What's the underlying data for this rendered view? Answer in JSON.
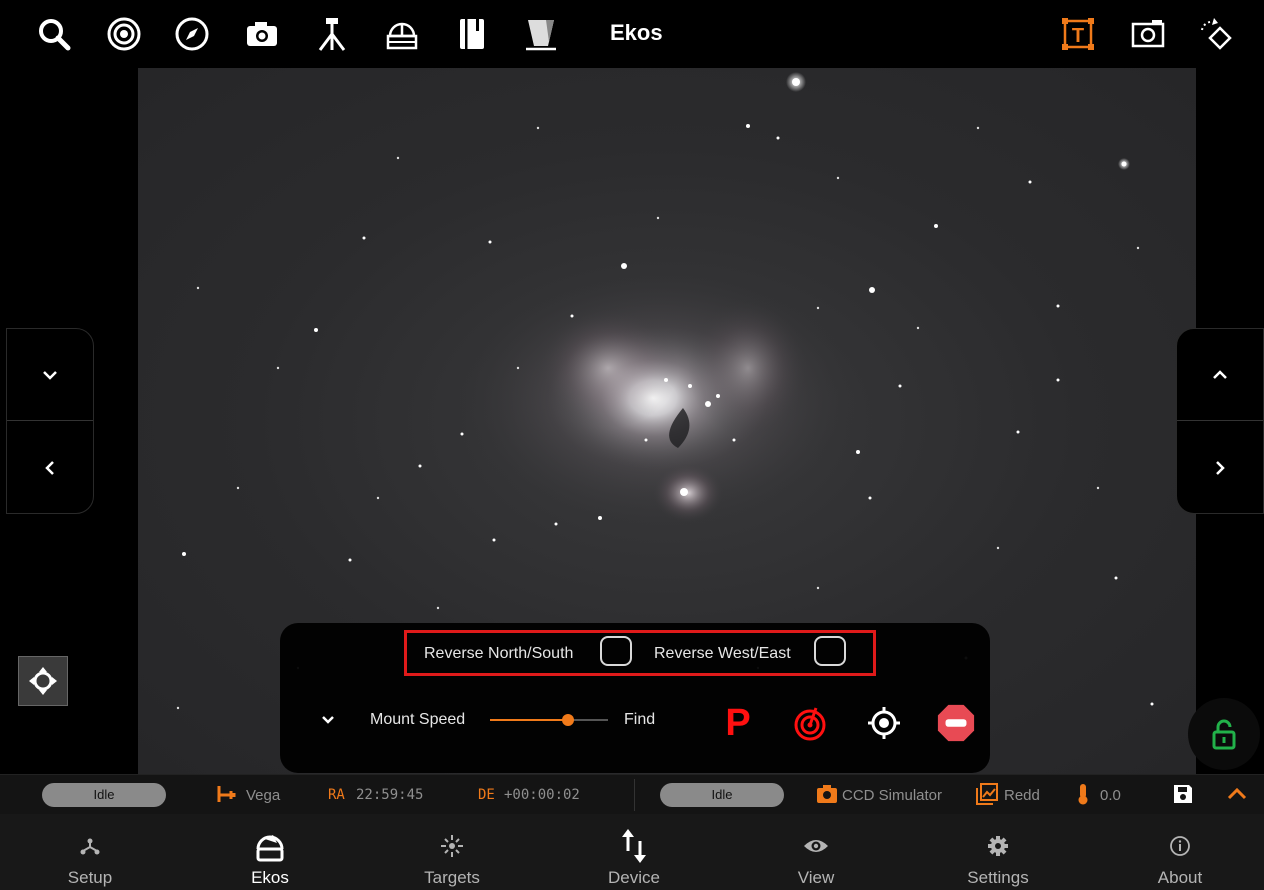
{
  "toolbar": {
    "title": "Ekos",
    "icons": [
      "search-icon",
      "target-icon",
      "compass-icon",
      "camera-icon",
      "telescope-icon",
      "observatory-icon",
      "notebook-icon",
      "flat-panel-icon",
      "text-frame-icon",
      "screen-capture-icon",
      "rotate-diamond-icon"
    ],
    "accent": "#f07a1a"
  },
  "mount_panel": {
    "reverse_ns_label": "Reverse North/South",
    "reverse_we_label": "Reverse West/East",
    "reverse_ns_checked": false,
    "reverse_we_checked": false,
    "speed_label": "Mount Speed",
    "speed_value_label": "Find",
    "speed_fraction": 0.66,
    "park_label": "P",
    "colors": {
      "highlight_border": "#e01a1a",
      "park": "#ff1010",
      "slider": "#f07a1a"
    }
  },
  "status_bar": {
    "mount_state": "Idle",
    "target_name": "Vega",
    "ra_label": "RA",
    "ra_value": "22:59:45",
    "de_label": "DE",
    "de_value": "+00:00:02",
    "camera_state": "Idle",
    "camera_name": "CCD Simulator",
    "filter_name": "Redd",
    "temperature": "0.0"
  },
  "bottom_nav": {
    "items": [
      {
        "label": "Setup",
        "icon": "setup-icon"
      },
      {
        "label": "Ekos",
        "icon": "ekos-dome-icon",
        "active": true
      },
      {
        "label": "Targets",
        "icon": "targets-icon"
      },
      {
        "label": "Device",
        "icon": "device-arrows-icon"
      },
      {
        "label": "View",
        "icon": "eye-icon"
      },
      {
        "label": "Settings",
        "icon": "gear-icon"
      },
      {
        "label": "About",
        "icon": "info-icon"
      }
    ]
  }
}
